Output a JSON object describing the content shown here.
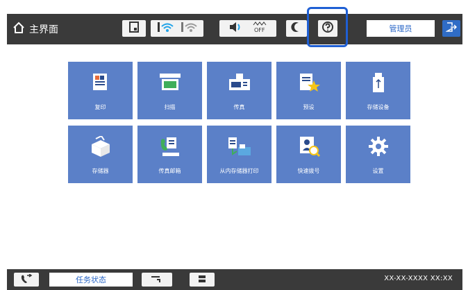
{
  "header": {
    "home_label": "主界面",
    "user_label": "管理员",
    "status_icons": [
      "document-status-icon",
      "wifi-icon",
      "wifi-direct-icon",
      "speaker-icon",
      "power-off-icon",
      "sleep-icon",
      "help-icon"
    ]
  },
  "tiles": [
    {
      "label": "复印",
      "icon": "copy-icon"
    },
    {
      "label": "扫描",
      "icon": "scan-icon"
    },
    {
      "label": "传真",
      "icon": "fax-icon"
    },
    {
      "label": "预设",
      "icon": "presets-icon"
    },
    {
      "label": "存储设备",
      "icon": "usb-storage-icon"
    },
    {
      "label": "存储器",
      "icon": "storage-box-icon"
    },
    {
      "label": "传真邮箱",
      "icon": "fax-box-icon"
    },
    {
      "label": "从内存储器打印",
      "icon": "print-from-memory-icon"
    },
    {
      "label": "快速拨号",
      "icon": "speed-dial-icon"
    },
    {
      "label": "设置",
      "icon": "settings-gear-icon"
    }
  ],
  "footer": {
    "job_status_label": "任务状态",
    "datetime": "XX-XX-XXXX XX:XX"
  },
  "colors": {
    "tile": "#5b80c8",
    "bar": "#3a3a3a",
    "accent": "#2a67c7",
    "highlight": "#1f5fd4"
  }
}
